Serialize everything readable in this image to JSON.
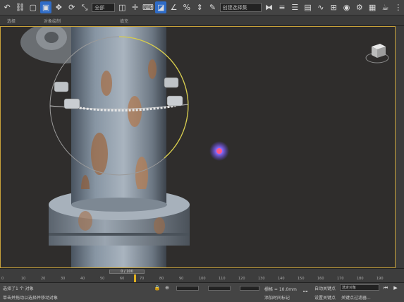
{
  "toolbar": {
    "dropdown_1": "全部",
    "dropdown_2": "创建选择集"
  },
  "labels": {
    "tab_1": "选择",
    "tab_2": "对象绘制",
    "tab_3": "填充"
  },
  "timeline": {
    "frame_counter": "0 / 100",
    "ticks": [
      "0",
      "10",
      "20",
      "30",
      "40",
      "50",
      "60",
      "70",
      "80",
      "90",
      "100",
      "110",
      "120",
      "130",
      "140",
      "150",
      "160",
      "170",
      "180",
      "190"
    ]
  },
  "status": {
    "selected_text": "选择了1 个 对象",
    "prompt_text": "单击并拖动以选择并移动对象",
    "grid_label": "栅格 = 10.0mm",
    "add_time_tag": "添加时间标记",
    "autokey_label": "自动关键点",
    "setkey_label": "设置关键点",
    "selection_dropdown": "选定对象",
    "keyfilter_label": "关键点过滤器..."
  },
  "colors": {
    "viewport_border": "#c8a23a",
    "active_tool": "#2f6cc7",
    "gizmo_yellow": "#d8cd4a",
    "cursor_glow": "#6b4cff"
  }
}
